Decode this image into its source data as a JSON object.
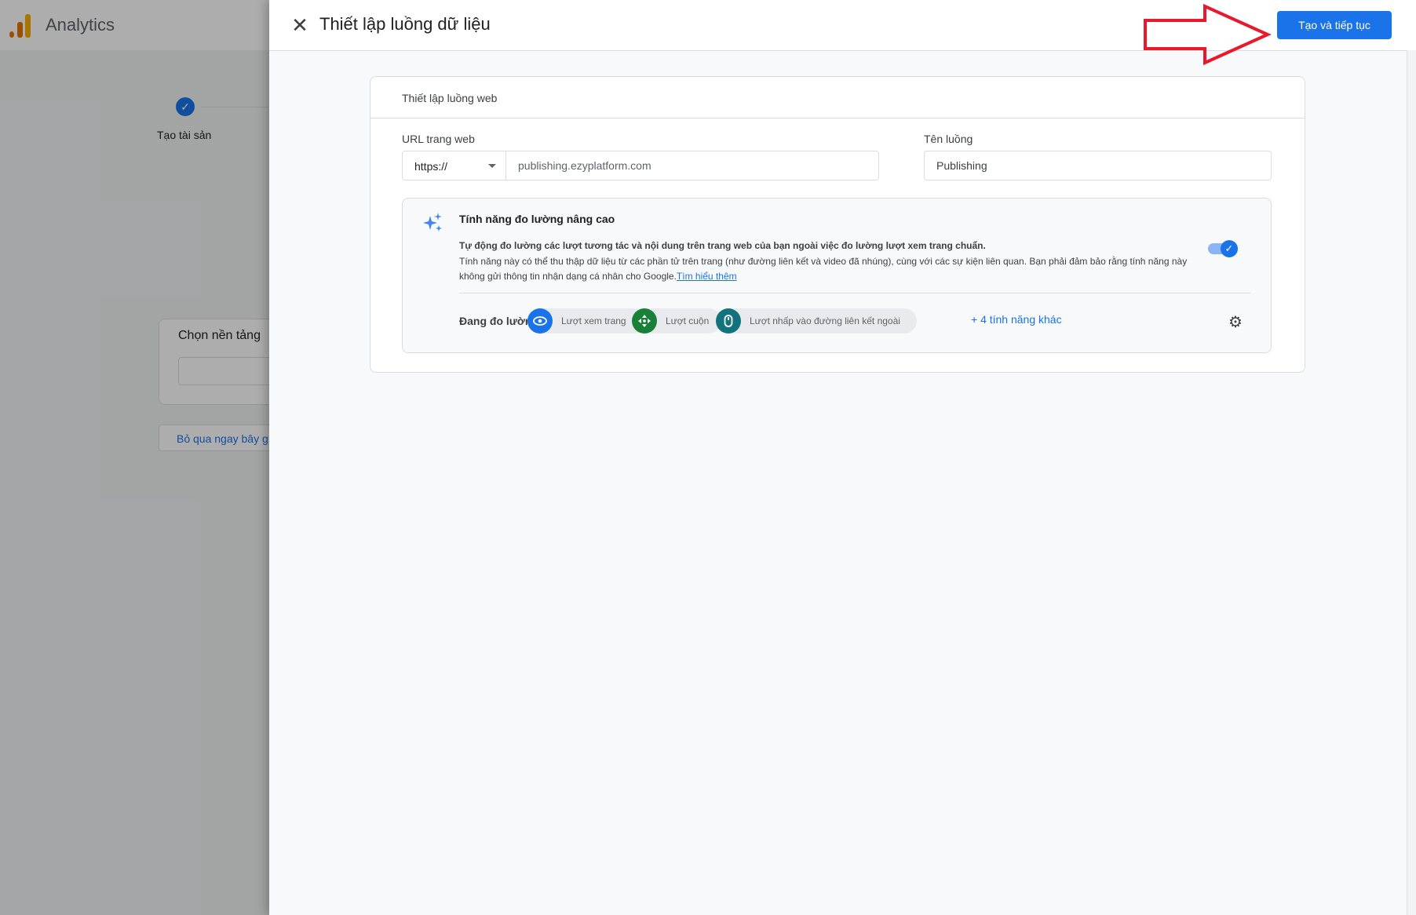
{
  "background": {
    "app_title": "Analytics",
    "step_label": "Tạo tài sản",
    "platform_title": "Chọn nền tảng",
    "skip_button": "Bỏ qua ngay bây g"
  },
  "drawer": {
    "title": "Thiết lập luồng dữ liệu",
    "primary_button": "Tạo và tiếp tục",
    "card": {
      "title": "Thiết lập luồng web",
      "url_label": "URL trang web",
      "protocol_value": "https://",
      "url_value": "publishing.ezyplatform.com",
      "stream_name_label": "Tên luồng",
      "stream_name_value": "Publishing"
    },
    "enhanced_measurement": {
      "title": "Tính năng đo lường nâng cao",
      "description_bold": "Tự động đo lường các lượt tương tác và nội dung trên trang web của bạn ngoài việc đo lường lượt xem trang chuẩn.",
      "description": "Tính năng này có thể thu thập dữ liệu từ các phần tử trên trang (như đường liên kết và video đã nhúng), cùng với các sự kiện liên quan. Bạn phải đảm bảo rằng tính năng này không gửi thông tin nhận dạng cá nhân cho Google.",
      "learn_more": "Tìm hiểu thêm",
      "enabled": true,
      "measuring_label": "Đang đo lường:",
      "chips": [
        {
          "label": "Lượt xem trang",
          "icon": "eye-icon",
          "color": "#1a73e8"
        },
        {
          "label": "Lượt cuộn",
          "icon": "scroll-arrows-icon",
          "color": "#188038"
        },
        {
          "label": "Lượt nhấp vào đường liên kết ngoài",
          "icon": "mouse-icon",
          "color": "#12737e"
        }
      ],
      "more_features": "+ 4 tính năng khác"
    }
  },
  "colors": {
    "accent": "#1a73e8",
    "annotation_arrow": "#e8192c"
  }
}
